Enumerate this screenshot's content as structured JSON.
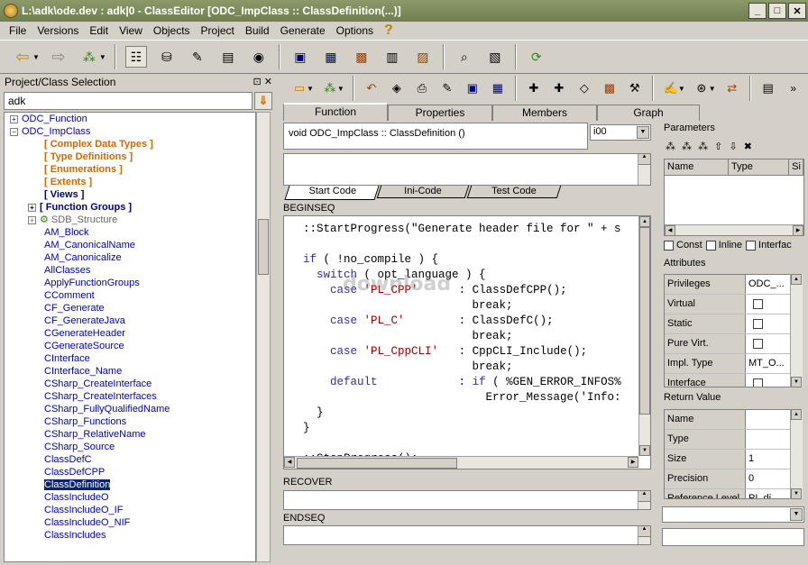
{
  "window": {
    "title": "L:\\adk\\ode.dev : adk|0 - ClassEditor [ODC_ImpClass :: ClassDefinition(...)]",
    "min": "_",
    "max": "□",
    "close": "✕"
  },
  "menu": [
    "File",
    "Versions",
    "Edit",
    "View",
    "Objects",
    "Project",
    "Build",
    "Generate",
    "Options"
  ],
  "left": {
    "header": "Project/Class Selection",
    "header_icons": "⊡ ✕",
    "search_value": "adk",
    "search_button": "⇓",
    "tree": [
      {
        "label": "ODC_Function",
        "exp": "+",
        "indent": 8,
        "style": "blue"
      },
      {
        "label": "ODC_ImpClass",
        "exp": "−",
        "indent": 8,
        "style": "blue"
      },
      {
        "label": "[ Complex Data Types ]",
        "exp": "",
        "indent": 44,
        "style": "orange"
      },
      {
        "label": "[ Type Definitions ]",
        "exp": "",
        "indent": 44,
        "style": "orange"
      },
      {
        "label": "[ Enumerations ]",
        "exp": "",
        "indent": 44,
        "style": "orange"
      },
      {
        "label": "[ Extents ]",
        "exp": "",
        "indent": 44,
        "style": "orange"
      },
      {
        "label": "[ Views ]",
        "exp": "",
        "indent": 44,
        "style": "navy"
      },
      {
        "label": "[ Function Groups ]",
        "exp": "+",
        "indent": 28,
        "style": "navy"
      },
      {
        "label": "SDB_Structure",
        "exp": "+",
        "indent": 28,
        "style": "gray",
        "icon": true
      },
      {
        "label": "AM_Block",
        "exp": "",
        "indent": 44,
        "style": "blue"
      },
      {
        "label": "AM_CanonicalName",
        "exp": "",
        "indent": 44,
        "style": "blue"
      },
      {
        "label": "AM_Canonicalize",
        "exp": "",
        "indent": 44,
        "style": "blue"
      },
      {
        "label": "AllClasses",
        "exp": "",
        "indent": 44,
        "style": "blue"
      },
      {
        "label": "ApplyFunctionGroups",
        "exp": "",
        "indent": 44,
        "style": "blue"
      },
      {
        "label": "CComment",
        "exp": "",
        "indent": 44,
        "style": "blue"
      },
      {
        "label": "CF_Generate",
        "exp": "",
        "indent": 44,
        "style": "blue"
      },
      {
        "label": "CF_GenerateJava",
        "exp": "",
        "indent": 44,
        "style": "blue"
      },
      {
        "label": "CGenerateHeader",
        "exp": "",
        "indent": 44,
        "style": "blue"
      },
      {
        "label": "CGenerateSource",
        "exp": "",
        "indent": 44,
        "style": "blue"
      },
      {
        "label": "CInterface",
        "exp": "",
        "indent": 44,
        "style": "blue"
      },
      {
        "label": "CInterface_Name",
        "exp": "",
        "indent": 44,
        "style": "blue"
      },
      {
        "label": "CSharp_CreateInterface",
        "exp": "",
        "indent": 44,
        "style": "blue"
      },
      {
        "label": "CSharp_CreateInterfaces",
        "exp": "",
        "indent": 44,
        "style": "blue"
      },
      {
        "label": "CSharp_FullyQualifiedName",
        "exp": "",
        "indent": 44,
        "style": "blue"
      },
      {
        "label": "CSharp_Functions",
        "exp": "",
        "indent": 44,
        "style": "blue"
      },
      {
        "label": "CSharp_RelativeName",
        "exp": "",
        "indent": 44,
        "style": "blue"
      },
      {
        "label": "CSharp_Source",
        "exp": "",
        "indent": 44,
        "style": "blue"
      },
      {
        "label": "ClassDefC",
        "exp": "",
        "indent": 44,
        "style": "blue"
      },
      {
        "label": "ClassDefCPP",
        "exp": "",
        "indent": 44,
        "style": "blue"
      },
      {
        "label": "ClassDefinition",
        "exp": "",
        "indent": 44,
        "style": "selected"
      },
      {
        "label": "ClassIncludeO",
        "exp": "",
        "indent": 44,
        "style": "blue"
      },
      {
        "label": "ClassIncludeO_IF",
        "exp": "",
        "indent": 44,
        "style": "blue"
      },
      {
        "label": "ClassIncludeO_NIF",
        "exp": "",
        "indent": 44,
        "style": "blue"
      },
      {
        "label": "ClassIncludes",
        "exp": "",
        "indent": 44,
        "style": "blue"
      }
    ]
  },
  "tabs": [
    "Function",
    "Properties",
    "Members",
    "Graph"
  ],
  "function": {
    "signature": "void ODC_ImpClass :: ClassDefinition ()",
    "select_value": "i00"
  },
  "code_tabs": [
    "Start Code",
    "Ini-Code",
    "Test Code"
  ],
  "sections": {
    "beginseq": "BEGINSEQ",
    "recover": "RECOVER",
    "endseq": "ENDSEQ"
  },
  "code_lines": [
    {
      "t": "  ::StartProgress(\"Generate header file for \" + s"
    },
    {
      "t": ""
    },
    {
      "t": "  if ( !no_compile ) {"
    },
    {
      "t": "    switch ( opt_language ) {"
    },
    {
      "t": "      case 'PL_CPP'      : ClassDefCPP();"
    },
    {
      "t": "                           break;"
    },
    {
      "t": "      case 'PL_C'        : ClassDefC();"
    },
    {
      "t": "                           break;"
    },
    {
      "t": "      case 'PL_CppCLI'   : CppCLI_Include();"
    },
    {
      "t": "                           break;"
    },
    {
      "t": "      default            : if ( %GEN_ERROR_INFOS%"
    },
    {
      "t": "                             Error_Message('Info:"
    },
    {
      "t": "    }"
    },
    {
      "t": "  }"
    },
    {
      "t": ""
    },
    {
      "t": "  ::StopProgress();"
    }
  ],
  "watermark": "download",
  "right": {
    "parameters_label": "Parameters",
    "param_icons": "⁂ ⁂ ⁂   ⇧ ⇩ ✖",
    "param_cols": [
      "Name",
      "Type",
      "Si"
    ],
    "checks": [
      "Const",
      "Inline",
      "Interfac"
    ],
    "attributes_label": "Attributes",
    "attributes": [
      {
        "k": "Privileges",
        "v": "ODC_...",
        "chk": false
      },
      {
        "k": "Virtual",
        "v": "",
        "chk": true
      },
      {
        "k": "Static",
        "v": "",
        "chk": true
      },
      {
        "k": "Pure Virt.",
        "v": "",
        "chk": true
      },
      {
        "k": "Impl. Type",
        "v": "MT_O...",
        "chk": false
      },
      {
        "k": "Interface",
        "v": "",
        "chk": true
      }
    ],
    "return_label": "Return Value",
    "return_rows": [
      {
        "k": "Name",
        "v": ""
      },
      {
        "k": "Type",
        "v": ""
      },
      {
        "k": "Size",
        "v": "1"
      },
      {
        "k": "Precision",
        "v": "0"
      },
      {
        "k": "Reference Level",
        "v": "PI_di..."
      }
    ]
  }
}
